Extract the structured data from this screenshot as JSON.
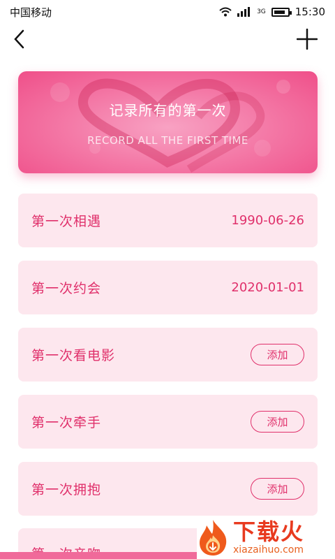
{
  "status_bar": {
    "carrier": "中国移动",
    "network": "3G",
    "time": "15:30"
  },
  "banner": {
    "title": "记录所有的第一次",
    "subtitle": "RECORD ALL THE FIRST TIME"
  },
  "records": [
    {
      "label": "第一次相遇",
      "date": "1990-06-26"
    },
    {
      "label": "第一次约会",
      "date": "2020-01-01"
    },
    {
      "label": "第一次看电影",
      "action": "添加"
    },
    {
      "label": "第一次牵手",
      "action": "添加"
    },
    {
      "label": "第一次拥抱",
      "action": "添加"
    },
    {
      "label": "第一次亲吻"
    }
  ],
  "watermark": {
    "name": "下载火",
    "url": "xiazaihuo.com"
  },
  "colors": {
    "accent": "#e0306b",
    "card_bg": "#fde7ee",
    "banner": "#f47ba8"
  }
}
